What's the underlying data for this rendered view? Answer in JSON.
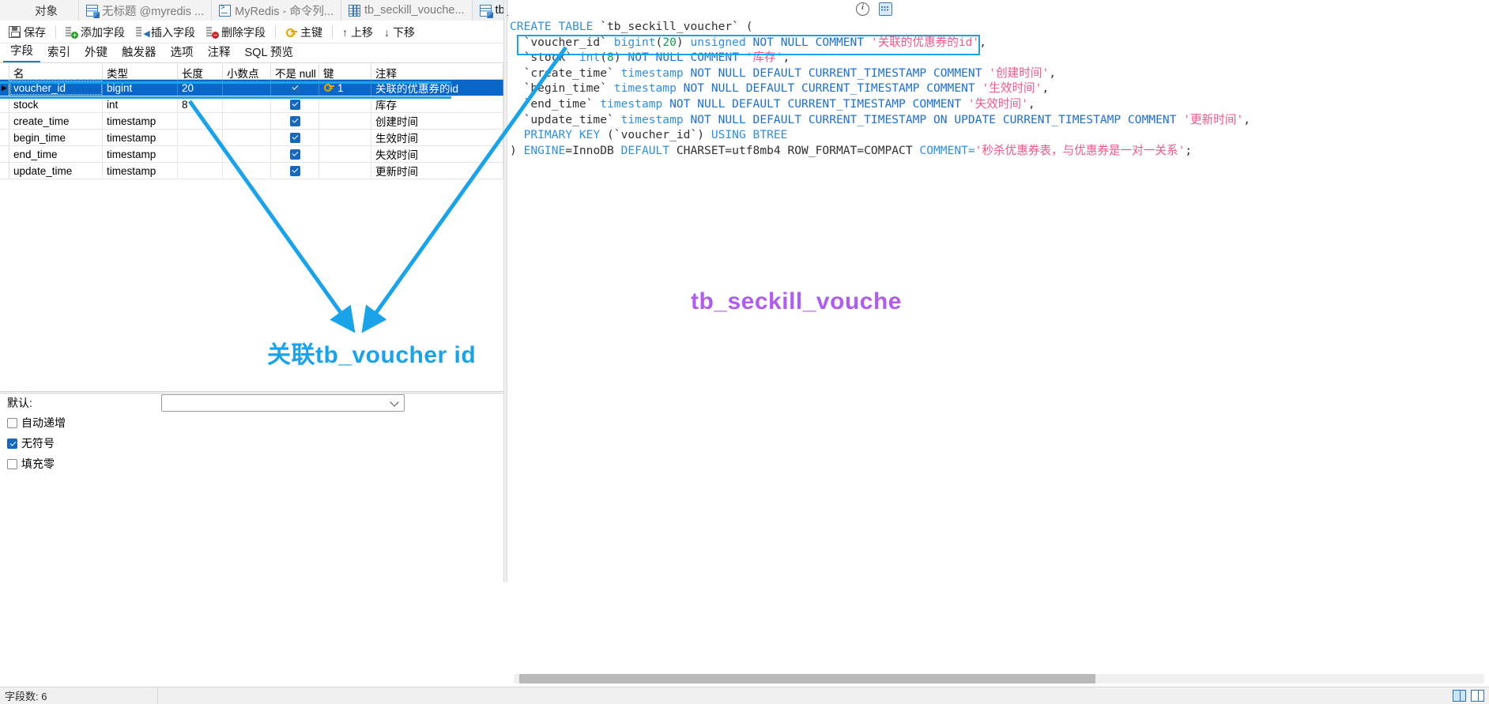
{
  "window": {
    "tabs": [
      {
        "label": "对象",
        "icon": "none",
        "active": false,
        "first": true
      },
      {
        "label": "无标题 @myredis ...",
        "icon": "designer-icon",
        "active": false
      },
      {
        "label": "MyRedis - 命令列...",
        "icon": "console-icon",
        "active": false
      },
      {
        "label": "tb_seckill_vouche...",
        "icon": "grid-icon",
        "active": false
      },
      {
        "label": "tb_seckill_vouche...",
        "icon": "designer-icon",
        "active": true
      }
    ]
  },
  "toolbar": {
    "buttons": [
      {
        "label": "保存",
        "icon": "save-icon"
      },
      {
        "label": "添加字段",
        "icon": "add-field-icon"
      },
      {
        "label": "插入字段",
        "icon": "insert-field-icon"
      },
      {
        "label": "删除字段",
        "icon": "delete-field-icon"
      },
      {
        "label": "主键",
        "icon": "key-icon"
      },
      {
        "label": "上移",
        "icon": "arrow-up-icon"
      },
      {
        "label": "下移",
        "icon": "arrow-down-icon"
      }
    ]
  },
  "subtabs": [
    {
      "label": "字段",
      "active": true
    },
    {
      "label": "索引",
      "active": false
    },
    {
      "label": "外键",
      "active": false
    },
    {
      "label": "触发器",
      "active": false
    },
    {
      "label": "选项",
      "active": false
    },
    {
      "label": "注释",
      "active": false
    },
    {
      "label": "SQL 预览",
      "active": false
    }
  ],
  "grid": {
    "columns": [
      "名",
      "类型",
      "长度",
      "小数点",
      "不是 null",
      "键",
      "注释"
    ],
    "rows": [
      {
        "name": "voucher_id",
        "type": "bigint",
        "length": "20",
        "decimals": "",
        "notnull": true,
        "key": "1",
        "comment": "关联的优惠券的id",
        "selected": true
      },
      {
        "name": "stock",
        "type": "int",
        "length": "8",
        "decimals": "",
        "notnull": true,
        "key": "",
        "comment": "库存",
        "selected": false
      },
      {
        "name": "create_time",
        "type": "timestamp",
        "length": "",
        "decimals": "",
        "notnull": true,
        "key": "",
        "comment": "创建时间",
        "selected": false
      },
      {
        "name": "begin_time",
        "type": "timestamp",
        "length": "",
        "decimals": "",
        "notnull": true,
        "key": "",
        "comment": "生效时间",
        "selected": false
      },
      {
        "name": "end_time",
        "type": "timestamp",
        "length": "",
        "decimals": "",
        "notnull": true,
        "key": "",
        "comment": "失效时间",
        "selected": false
      },
      {
        "name": "update_time",
        "type": "timestamp",
        "length": "",
        "decimals": "",
        "notnull": true,
        "key": "",
        "comment": "更新时间",
        "selected": false
      }
    ]
  },
  "properties": {
    "default_label": "默认:",
    "default_value": "",
    "checkboxes": [
      {
        "label": "自动递增",
        "checked": false
      },
      {
        "label": "无符号",
        "checked": true
      },
      {
        "label": "填充零",
        "checked": false
      }
    ]
  },
  "sql": {
    "lines": [
      [
        {
          "t": "CREATE TABLE ",
          "c": "kw"
        },
        {
          "t": "`tb_seckill_voucher` (",
          "c": "plain"
        }
      ],
      [
        {
          "t": "  `voucher_id` ",
          "c": "plain"
        },
        {
          "t": "bigint",
          "c": "kw"
        },
        {
          "t": "(",
          "c": "plain"
        },
        {
          "t": "20",
          "c": "num"
        },
        {
          "t": ") ",
          "c": "plain"
        },
        {
          "t": "unsigned ",
          "c": "kw"
        },
        {
          "t": "NOT NULL COMMENT ",
          "c": "kw2"
        },
        {
          "t": "'关联的优惠券的id'",
          "c": "str"
        },
        {
          "t": ",",
          "c": "plain"
        }
      ],
      [
        {
          "t": "  `stock` ",
          "c": "plain"
        },
        {
          "t": "int",
          "c": "kw"
        },
        {
          "t": "(",
          "c": "plain"
        },
        {
          "t": "8",
          "c": "num"
        },
        {
          "t": ") ",
          "c": "plain"
        },
        {
          "t": "NOT NULL COMMENT ",
          "c": "kw2"
        },
        {
          "t": "'库存'",
          "c": "str"
        },
        {
          "t": ",",
          "c": "plain"
        }
      ],
      [
        {
          "t": "  `create_time` ",
          "c": "plain"
        },
        {
          "t": "timestamp ",
          "c": "kw"
        },
        {
          "t": "NOT NULL DEFAULT CURRENT_TIMESTAMP COMMENT ",
          "c": "kw2"
        },
        {
          "t": "'创建时间'",
          "c": "str"
        },
        {
          "t": ",",
          "c": "plain"
        }
      ],
      [
        {
          "t": "  `begin_time` ",
          "c": "plain"
        },
        {
          "t": "timestamp ",
          "c": "kw"
        },
        {
          "t": "NOT NULL DEFAULT CURRENT_TIMESTAMP COMMENT ",
          "c": "kw2"
        },
        {
          "t": "'生效时间'",
          "c": "str"
        },
        {
          "t": ",",
          "c": "plain"
        }
      ],
      [
        {
          "t": "  `end_time` ",
          "c": "plain"
        },
        {
          "t": "timestamp ",
          "c": "kw"
        },
        {
          "t": "NOT NULL DEFAULT CURRENT_TIMESTAMP COMMENT ",
          "c": "kw2"
        },
        {
          "t": "'失效时间'",
          "c": "str"
        },
        {
          "t": ",",
          "c": "plain"
        }
      ],
      [
        {
          "t": "  `update_time` ",
          "c": "plain"
        },
        {
          "t": "timestamp ",
          "c": "kw"
        },
        {
          "t": "NOT NULL DEFAULT CURRENT_TIMESTAMP ON UPDATE CURRENT_TIMESTAMP COMMENT ",
          "c": "kw2"
        },
        {
          "t": "'更新时间'",
          "c": "str"
        },
        {
          "t": ",",
          "c": "plain"
        }
      ],
      [
        {
          "t": "  PRIMARY KEY ",
          "c": "kw"
        },
        {
          "t": "(`voucher_id`) ",
          "c": "plain"
        },
        {
          "t": "USING BTREE",
          "c": "kw"
        }
      ],
      [
        {
          "t": ") ",
          "c": "plain"
        },
        {
          "t": "ENGINE",
          "c": "kw"
        },
        {
          "t": "=InnoDB ",
          "c": "plain"
        },
        {
          "t": "DEFAULT ",
          "c": "kw"
        },
        {
          "t": "CHARSET=utf8mb4 ROW_FORMAT=COMPACT ",
          "c": "plain"
        },
        {
          "t": "COMMENT=",
          "c": "kw"
        },
        {
          "t": "'秒杀优惠券表，与优惠券是一对一关系'",
          "c": "str"
        },
        {
          "t": ";",
          "c": "plain"
        }
      ]
    ],
    "highlighted_line_index": 1,
    "top_icons": [
      {
        "name": "info-icon"
      },
      {
        "name": "keyboard-icon"
      }
    ]
  },
  "annotations": [
    {
      "text": "关联tb_voucher id",
      "color": "#1aa3e8"
    },
    {
      "text": "tb_seckill_vouche",
      "color": "#b05cf0"
    }
  ],
  "statusbar": {
    "left": "字段数: 6"
  },
  "colors": {
    "accent_blue": "#1aa3e8",
    "selection_blue": "#0a67c8",
    "purple": "#b05cf0",
    "sql_keyword": "#2f8fe0",
    "sql_string": "#f2558a",
    "sql_number": "#179b49"
  }
}
